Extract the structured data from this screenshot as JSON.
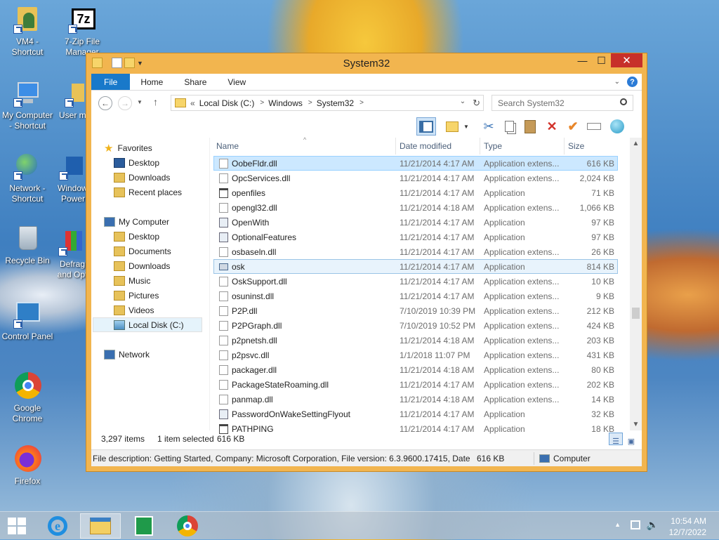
{
  "desktop": {
    "icons": [
      {
        "label": "VM4 -\nShortcut"
      },
      {
        "label": "7-Zip File\nManager"
      },
      {
        "label": "My Computer\n- Shortcut"
      },
      {
        "label": "User m"
      },
      {
        "label": "Network -\nShortcut"
      },
      {
        "label": "Windows\nPower"
      },
      {
        "label": "Recycle Bin"
      },
      {
        "label": "Defrag\nand Opt"
      },
      {
        "label": "Control Panel"
      },
      {
        "label": "Google\nChrome"
      },
      {
        "label": "Firefox"
      }
    ]
  },
  "window": {
    "title": "System32",
    "min_symbol": "—",
    "max_symbol": "☐",
    "close_symbol": "✕",
    "ribbon_tabs": [
      "File",
      "Home",
      "Share",
      "View"
    ],
    "address": {
      "chevron": "«",
      "crumbs": [
        "Local Disk (C:)",
        "Windows",
        "System32"
      ]
    },
    "search_placeholder": "Search System32",
    "favorites": {
      "header": "Favorites",
      "items": [
        "Desktop",
        "Downloads",
        "Recent places"
      ]
    },
    "computer": {
      "header": "My Computer",
      "items": [
        "Desktop",
        "Documents",
        "Downloads",
        "Music",
        "Pictures",
        "Videos",
        "Local Disk (C:)"
      ]
    },
    "network_label": "Network",
    "columns": {
      "name": "Name",
      "date": "Date modified",
      "type": "Type",
      "size": "Size"
    },
    "files": [
      {
        "name": "OobeFldr.dll",
        "date": "11/21/2014 4:17 AM",
        "type": "Application extens...",
        "size": "616 KB",
        "kind": "dll"
      },
      {
        "name": "OpcServices.dll",
        "date": "11/21/2014 4:17 AM",
        "type": "Application extens...",
        "size": "2,024 KB",
        "kind": "dll"
      },
      {
        "name": "openfiles",
        "date": "11/21/2014 4:17 AM",
        "type": "Application",
        "size": "71 KB",
        "kind": "exe"
      },
      {
        "name": "opengl32.dll",
        "date": "11/21/2014 4:18 AM",
        "type": "Application extens...",
        "size": "1,066 KB",
        "kind": "dll"
      },
      {
        "name": "OpenWith",
        "date": "11/21/2014 4:17 AM",
        "type": "Application",
        "size": "97 KB",
        "kind": "app"
      },
      {
        "name": "OptionalFeatures",
        "date": "11/21/2014 4:17 AM",
        "type": "Application",
        "size": "97 KB",
        "kind": "app"
      },
      {
        "name": "osbaseln.dll",
        "date": "11/21/2014 4:17 AM",
        "type": "Application extens...",
        "size": "26 KB",
        "kind": "dll"
      },
      {
        "name": "osk",
        "date": "11/21/2014 4:17 AM",
        "type": "Application",
        "size": "814 KB",
        "kind": "kbd"
      },
      {
        "name": "OskSupport.dll",
        "date": "11/21/2014 4:17 AM",
        "type": "Application extens...",
        "size": "10 KB",
        "kind": "dll"
      },
      {
        "name": "osuninst.dll",
        "date": "11/21/2014 4:17 AM",
        "type": "Application extens...",
        "size": "9 KB",
        "kind": "dll"
      },
      {
        "name": "P2P.dll",
        "date": "7/10/2019 10:39 PM",
        "type": "Application extens...",
        "size": "212 KB",
        "kind": "dll"
      },
      {
        "name": "P2PGraph.dll",
        "date": "7/10/2019 10:52 PM",
        "type": "Application extens...",
        "size": "424 KB",
        "kind": "dll"
      },
      {
        "name": "p2pnetsh.dll",
        "date": "11/21/2014 4:18 AM",
        "type": "Application extens...",
        "size": "203 KB",
        "kind": "dll"
      },
      {
        "name": "p2psvc.dll",
        "date": "1/1/2018 11:07 PM",
        "type": "Application extens...",
        "size": "431 KB",
        "kind": "dll"
      },
      {
        "name": "packager.dll",
        "date": "11/21/2014 4:18 AM",
        "type": "Application extens...",
        "size": "80 KB",
        "kind": "dll"
      },
      {
        "name": "PackageStateRoaming.dll",
        "date": "11/21/2014 4:17 AM",
        "type": "Application extens...",
        "size": "202 KB",
        "kind": "dll"
      },
      {
        "name": "panmap.dll",
        "date": "11/21/2014 4:18 AM",
        "type": "Application extens...",
        "size": "14 KB",
        "kind": "dll"
      },
      {
        "name": "PasswordOnWakeSettingFlyout",
        "date": "11/21/2014 4:17 AM",
        "type": "Application",
        "size": "32 KB",
        "kind": "app"
      },
      {
        "name": "PATHPING",
        "date": "11/21/2014 4:17 AM",
        "type": "Application",
        "size": "18 KB",
        "kind": "exe"
      }
    ],
    "status": {
      "count": "3,297 items",
      "selected": "1 item selected",
      "selected_size": "616 KB"
    },
    "description": {
      "text": "File description: Getting Started, Company: Microsoft Corporation, File version: 6.3.9600.17415, Date cre",
      "size": "616 KB",
      "location": "Computer"
    }
  },
  "taskbar": {
    "time": "10:54 AM",
    "date": "12/7/2022"
  },
  "colors": {
    "accent": "#1979ca",
    "window_frame": "#f2b54f",
    "close": "#c7302a",
    "selection": "#cce8ff"
  }
}
